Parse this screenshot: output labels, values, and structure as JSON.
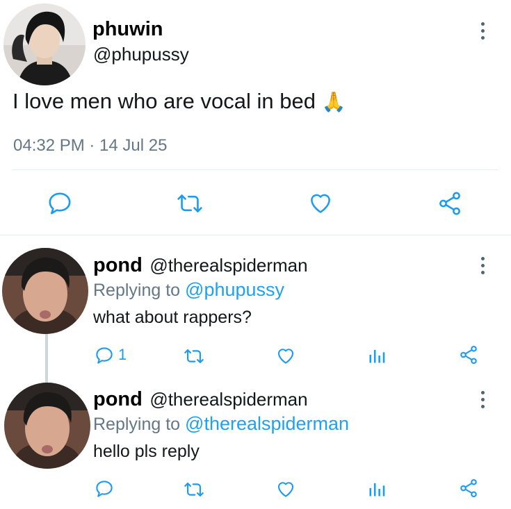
{
  "main_tweet": {
    "display_name": "phuwin",
    "handle": "@phupussy",
    "text": "I love men who are vocal in bed",
    "emoji": "🙏",
    "timestamp": "04:32 PM · 14 Jul 25"
  },
  "replies": [
    {
      "display_name": "pond",
      "handle": "@therealspiderman",
      "replying_label": "Replying to",
      "replying_to": "@phupussy",
      "text": "what about rappers?",
      "reply_count": "1"
    },
    {
      "display_name": "pond",
      "handle": "@therealspiderman",
      "replying_label": "Replying to",
      "replying_to": "@therealspiderman",
      "text": "hello pls reply",
      "reply_count": ""
    }
  ],
  "icons": {
    "reply": "speech-bubble-icon",
    "retweet": "retweet-icon",
    "like": "heart-icon",
    "analytics": "bar-chart-icon",
    "share": "share-nodes-icon",
    "more": "vertical-dots-icon"
  },
  "colors": {
    "accent": "#1da1f2",
    "icon": "#1d9bf0",
    "muted": "#657786",
    "divider": "#e6ecf0"
  }
}
